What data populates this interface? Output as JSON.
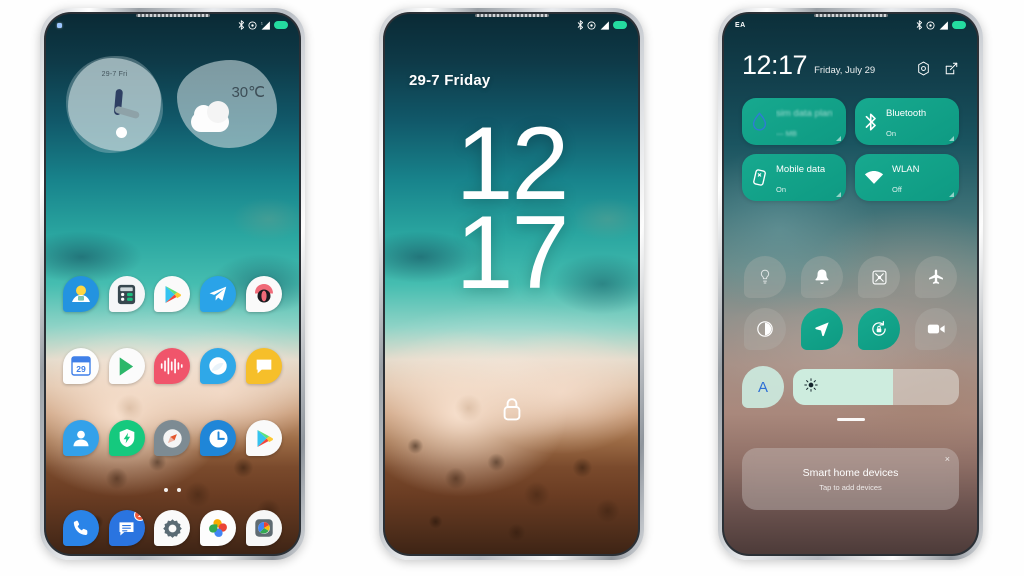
{
  "statusbar": {
    "icons": [
      "bluetooth-icon",
      "alarm-icon",
      "signal-icon",
      "battery-icon"
    ],
    "carrier_phone3": "EA",
    "battery_color": "#24dca0"
  },
  "phone1": {
    "name": "home-screen",
    "clock_widget": {
      "date": "29-7 Fri"
    },
    "weather_widget": {
      "temperature": "30℃",
      "condition_icon": "partly-cloudy-icon"
    },
    "rows": [
      {
        "apps": [
          {
            "name": "photos-app",
            "label": "Photos"
          },
          {
            "name": "calculator-app",
            "label": "Calculator"
          },
          {
            "name": "play-store-app",
            "label": "Play Store"
          },
          {
            "name": "telegram-app",
            "label": "Telegram"
          },
          {
            "name": "opera-app",
            "label": "Opera"
          }
        ]
      },
      {
        "apps": [
          {
            "name": "calendar-app",
            "label": "Calendar",
            "day": "29"
          },
          {
            "name": "google-play-games-app",
            "label": "Play Games"
          },
          {
            "name": "recorder-app",
            "label": "Recorder"
          },
          {
            "name": "mi-browser-app",
            "label": "Browser"
          },
          {
            "name": "messages-yellow-app",
            "label": "Messages"
          }
        ]
      },
      {
        "apps": [
          {
            "name": "contacts-app",
            "label": "Contacts"
          },
          {
            "name": "security-app",
            "label": "Security"
          },
          {
            "name": "compass-app",
            "label": "Compass"
          },
          {
            "name": "clock-app",
            "label": "Clock"
          },
          {
            "name": "play-store-app-2",
            "label": "Play Store"
          }
        ]
      }
    ],
    "page_dots": 2,
    "dock": [
      {
        "name": "phone-app",
        "label": "Phone"
      },
      {
        "name": "sms-app",
        "label": "Messages",
        "badge": "1"
      },
      {
        "name": "settings-app",
        "label": "Settings"
      },
      {
        "name": "google-photos-app",
        "label": "Photos"
      },
      {
        "name": "camera-app",
        "label": "Camera"
      }
    ]
  },
  "phone2": {
    "name": "lock-screen",
    "date": "29-7 Friday",
    "time_hour": "12",
    "time_minute": "17",
    "lock_icon": "lock-icon"
  },
  "phone3": {
    "name": "control-center",
    "clock": "12:17",
    "date": "Friday, July 29",
    "actions": [
      {
        "name": "settings-gear-icon"
      },
      {
        "name": "edit-icon"
      }
    ],
    "big_tiles": [
      {
        "name": "data-plan-tile",
        "title": "sim data plan",
        "sub": "— MB",
        "icon": "data-drop-icon",
        "state": "faded"
      },
      {
        "name": "bluetooth-tile",
        "title": "Bluetooth",
        "sub": "On",
        "icon": "bluetooth-icon",
        "state": "on"
      },
      {
        "name": "mobile-data-tile",
        "title": "Mobile data",
        "sub": "On",
        "icon": "mobile-data-icon",
        "state": "on"
      },
      {
        "name": "wlan-tile",
        "title": "WLAN",
        "sub": "Off",
        "icon": "wifi-icon",
        "state": "on"
      }
    ],
    "toggles": [
      {
        "name": "flashlight-toggle",
        "icon": "flashlight-icon",
        "state": "off"
      },
      {
        "name": "silent-toggle",
        "icon": "bell-icon",
        "state": "off"
      },
      {
        "name": "screenshot-toggle",
        "icon": "screenshot-icon",
        "state": "off"
      },
      {
        "name": "airplane-mode-toggle",
        "icon": "airplane-icon",
        "state": "off"
      },
      {
        "name": "dark-mode-toggle",
        "icon": "contrast-icon",
        "state": "off"
      },
      {
        "name": "location-toggle",
        "icon": "location-arrow-icon",
        "state": "on"
      },
      {
        "name": "auto-rotate-toggle",
        "icon": "rotate-lock-icon",
        "state": "on"
      },
      {
        "name": "screen-recorder-toggle",
        "icon": "video-camera-icon",
        "state": "off"
      }
    ],
    "brightness": {
      "auto_label": "A",
      "icon": "brightness-sun-icon",
      "level_percent": 60
    },
    "notification": {
      "title": "Smart home devices",
      "subtitle": "Tap to add devices",
      "close_label": "×"
    }
  }
}
